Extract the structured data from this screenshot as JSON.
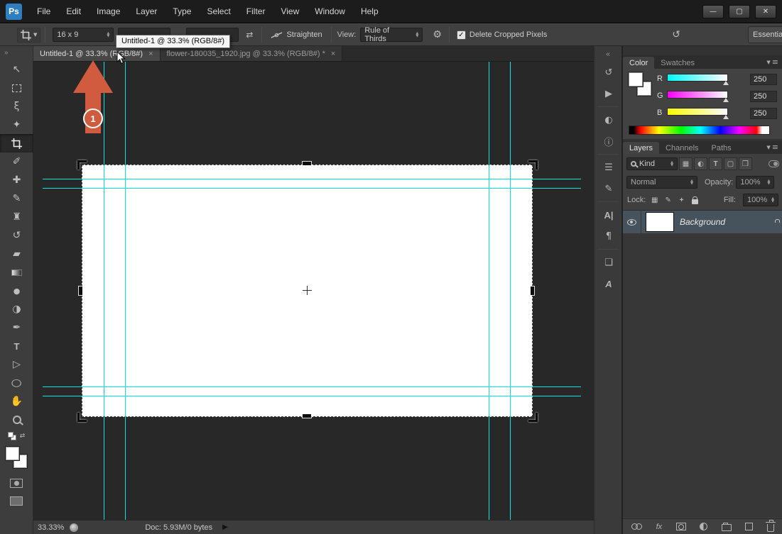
{
  "colors": {
    "logo_blue": "#2d7fc1",
    "guide_cyan": "#00e5e5",
    "annotation_orange": "#d05b3e"
  },
  "menubar": {
    "logo": "Ps",
    "items": [
      "File",
      "Edit",
      "Image",
      "Layer",
      "Type",
      "Select",
      "Filter",
      "View",
      "Window",
      "Help"
    ]
  },
  "options_bar": {
    "preset_value": "16 x 9",
    "straighten_label": "Straighten",
    "view_label": "View:",
    "view_value": "Rule of Thirds",
    "delete_cropped_label": "Delete Cropped Pixels",
    "workspace_label": "Essential"
  },
  "tooltip": {
    "text": "Untitled-1 @ 33.3% (RGB/8#)"
  },
  "tabs": [
    {
      "label": "Untitled-1 @ 33.3% (RGB/8#)",
      "close": "×"
    },
    {
      "label": "flower-180035_1920.jpg @ 33.3% (RGB/8#) *",
      "close": "×"
    }
  ],
  "annotation": {
    "step_number": "1"
  },
  "color_panel": {
    "tab_color": "Color",
    "tab_swatches": "Swatches",
    "channels": [
      {
        "label": "R",
        "value": "250"
      },
      {
        "label": "G",
        "value": "250"
      },
      {
        "label": "B",
        "value": "250"
      }
    ]
  },
  "layers_panel": {
    "tab_layers": "Layers",
    "tab_channels": "Channels",
    "tab_paths": "Paths",
    "kind_label": "Kind",
    "blend_mode_value": "Normal",
    "opacity_label": "Opacity:",
    "opacity_value": "100%",
    "lock_label": "Lock:",
    "fill_label": "Fill:",
    "fill_value": "100%",
    "fx_label": "fx",
    "layers": [
      {
        "name": "Background"
      }
    ]
  },
  "status_bar": {
    "zoom": "33.33%",
    "doc_info": "Doc: 5.93M/0 bytes"
  }
}
